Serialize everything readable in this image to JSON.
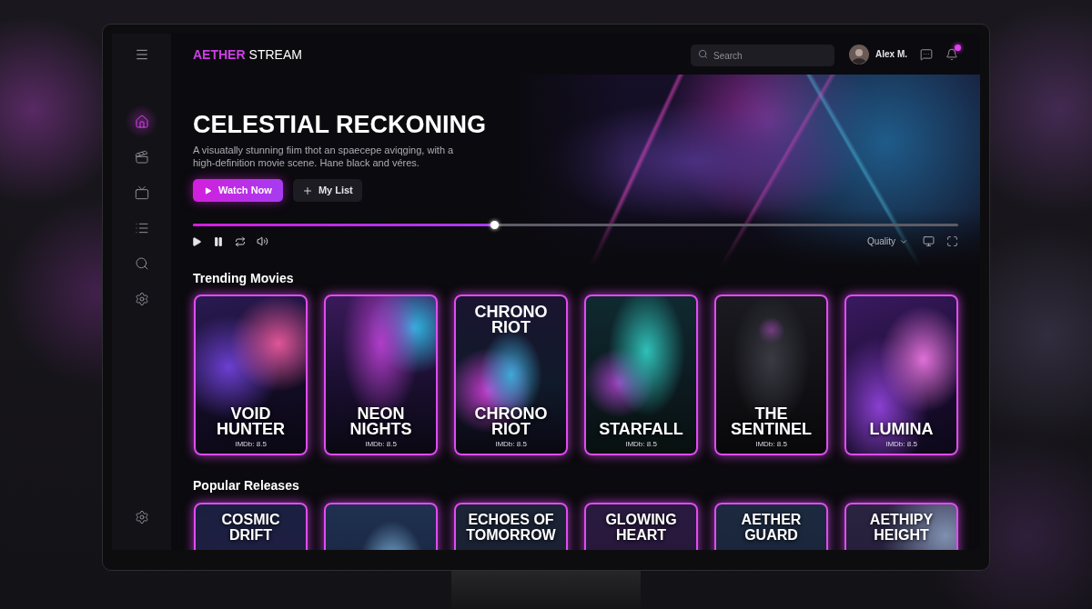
{
  "header": {
    "logo": {
      "accent": "AETHER",
      "rest": "STREAM"
    },
    "search": {
      "placeholder": "Search"
    },
    "user": {
      "name": "Alex M."
    },
    "notifications": {
      "unread": true
    }
  },
  "sidebar": {
    "items": [
      {
        "selected": true
      },
      {
        "selected": false
      },
      {
        "selected": false
      },
      {
        "selected": false
      },
      {
        "selected": false
      },
      {
        "selected": false
      }
    ]
  },
  "hero": {
    "title": "CELESTIAL RECKONING",
    "description": "A visuatally stunning fiim thot an spaecepe aviqging, with a high-definition movie scene. Hane black and véres.",
    "buttons": [
      {
        "kind": "primary",
        "label": "Watch Now"
      },
      {
        "kind": "secondary",
        "label": "My List"
      }
    ]
  },
  "player": {
    "level": 0.394,
    "quality": "Quality"
  },
  "sections": [
    {
      "kind": "overlay",
      "title": "Trending Movies",
      "cards": [
        {
          "kind": "titled",
          "title": "VOID HUNTER",
          "rating": "IMDb: 8.5"
        },
        {
          "kind": "titled",
          "title": "NEON NIGHTS",
          "rating": "IMDb: 8.5"
        },
        {
          "kind": "titled",
          "poster_text": "CHRONO RIOT",
          "title": "CHRONO RIOT",
          "rating": "IMDb: 8.5"
        },
        {
          "kind": "titled",
          "title": "STARFALL",
          "rating": "IMDb: 8.5"
        },
        {
          "kind": "titled",
          "title": "THE SENTINEL",
          "rating": "IMDb: 8.5"
        },
        {
          "kind": "titled",
          "title": "LUMINA",
          "rating": "IMDb: 8.5"
        }
      ]
    },
    {
      "kind": "header",
      "title": "Popular Releases",
      "cards": [
        {
          "kind": "titled",
          "title": "COSMIC DRIFT"
        },
        {
          "kind": "untitled"
        },
        {
          "kind": "titled",
          "title": "ECHOES OF TOMORROW"
        },
        {
          "kind": "titled",
          "title": "GLOWING HEART"
        },
        {
          "kind": "titled",
          "title": "AETHER GUARD"
        },
        {
          "kind": "titled",
          "title": "AETHIPY HEIGHT"
        }
      ]
    }
  ]
}
